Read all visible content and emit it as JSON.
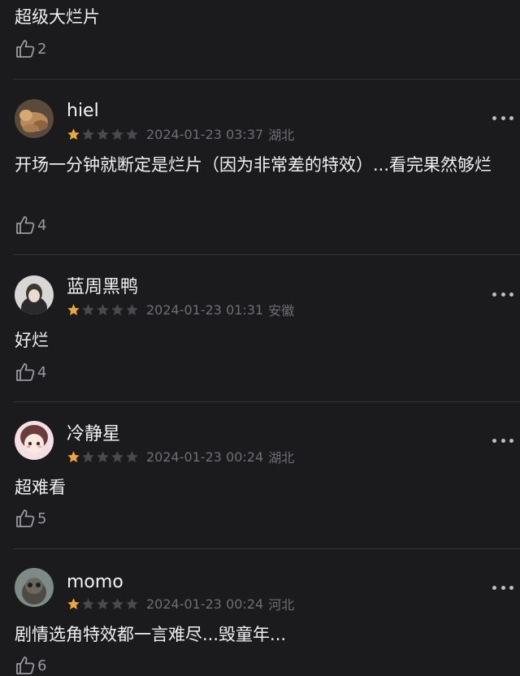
{
  "colors": {
    "background": "#1b1b1d",
    "star_filled": "#f0a63a",
    "star_empty": "#4a4a4e",
    "meta_text": "#6e6e73"
  },
  "top_review": {
    "content": "超级大烂片",
    "likes": "2",
    "like_icon": "thumbs-up-icon"
  },
  "reviews": [
    {
      "username": "hiel",
      "rating": 1,
      "rating_max": 5,
      "date": "2024-01-23 03:37",
      "location": "湖北",
      "content": "开场一分钟就断定是烂片（因为非常差的特效）...看完果然够烂",
      "likes": "4"
    },
    {
      "username": "蓝周黑鸭",
      "rating": 1,
      "rating_max": 5,
      "date": "2024-01-23 01:31",
      "location": "安徽",
      "content": "好烂",
      "likes": "4"
    },
    {
      "username": "冷静星",
      "rating": 1,
      "rating_max": 5,
      "date": "2024-01-23 00:24",
      "location": "湖北",
      "content": "超难看",
      "likes": "5"
    },
    {
      "username": "momo",
      "rating": 1,
      "rating_max": 5,
      "date": "2024-01-23 00:24",
      "location": "河北",
      "content": "剧情选角特效都一言难尽...毁童年...",
      "likes": "6"
    }
  ]
}
